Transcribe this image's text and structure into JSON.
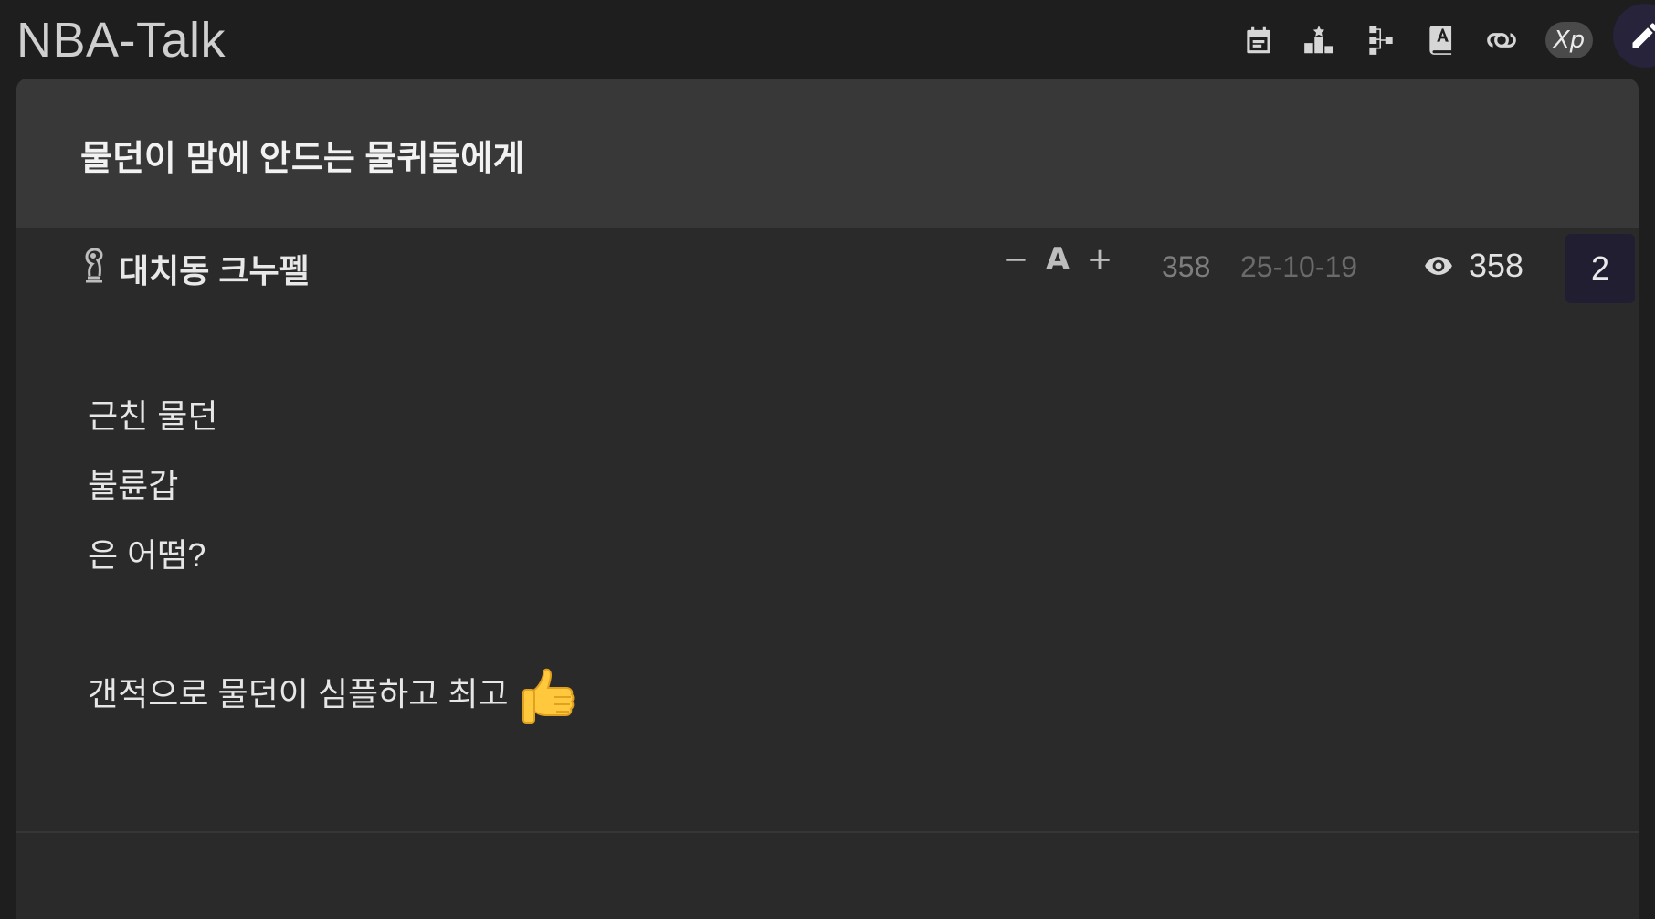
{
  "app": {
    "title": "NBA-Talk"
  },
  "toolbar": {
    "xp_label": "Xp",
    "icons": [
      "calendar-icon",
      "ranking-icon",
      "sitemap-icon",
      "dictionary-icon",
      "link-icon",
      "pencil-icon"
    ]
  },
  "post": {
    "title": "물던이 맘에 안드는 물퀴들에게",
    "author": "대치동 크누펠",
    "font_minus": "−",
    "font_a": "A",
    "font_plus": "+",
    "number": "358",
    "date": "25-10-19",
    "views": "358",
    "comments": "2",
    "body": {
      "line1": "근친 물던",
      "line2": "불륜갑",
      "line3": "은 어떰?",
      "line4": "갠적으로 물던이 심플하고 최고"
    }
  },
  "colors": {
    "background": "#1e1e1e",
    "card": "#2a2a2a",
    "title_bar": "#383838",
    "write_button": "#26233a",
    "comment_badge": "#201e30"
  }
}
